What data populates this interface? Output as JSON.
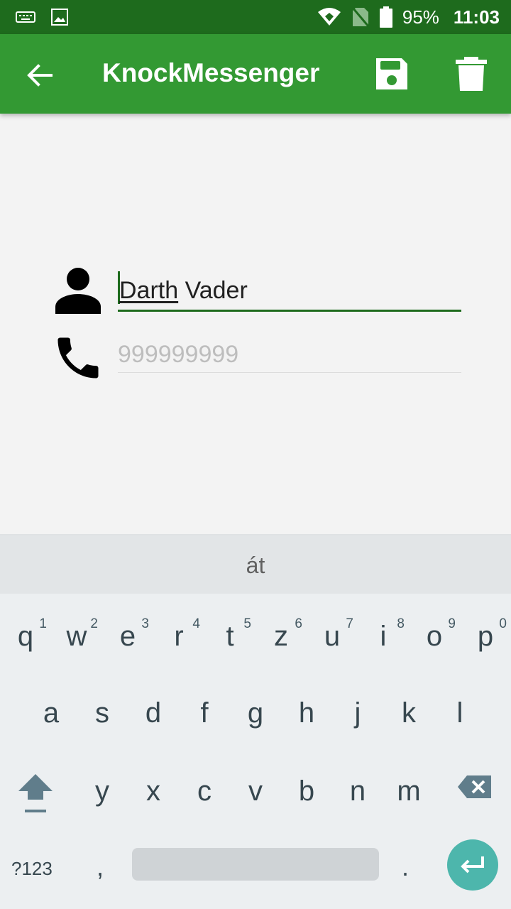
{
  "status_bar": {
    "battery": "95%",
    "time": "11:03"
  },
  "app_bar": {
    "title": "KnockMessenger",
    "icons": [
      "arrow-back-icon",
      "save-icon",
      "delete-icon"
    ]
  },
  "form": {
    "name_value_underlined": "Darth",
    "name_value_rest": " Vader",
    "phone_placeholder": "999999999"
  },
  "keyboard": {
    "suggestion": "át",
    "row1": [
      {
        "letter": "q",
        "hint": "1"
      },
      {
        "letter": "w",
        "hint": "2"
      },
      {
        "letter": "e",
        "hint": "3"
      },
      {
        "letter": "r",
        "hint": "4"
      },
      {
        "letter": "t",
        "hint": "5"
      },
      {
        "letter": "z",
        "hint": "6"
      },
      {
        "letter": "u",
        "hint": "7"
      },
      {
        "letter": "i",
        "hint": "8"
      },
      {
        "letter": "o",
        "hint": "9"
      },
      {
        "letter": "p",
        "hint": "0"
      }
    ],
    "row2": [
      "a",
      "s",
      "d",
      "f",
      "g",
      "h",
      "j",
      "k",
      "l"
    ],
    "row3": [
      "y",
      "x",
      "c",
      "v",
      "b",
      "n",
      "m"
    ],
    "symbols_label": "?123",
    "comma_label": ",",
    "period_label": "."
  },
  "colors": {
    "status_bar": "#1e6b1d",
    "app_bar": "#339933",
    "accent": "#1e6b1d",
    "enter_key": "#4db6ac"
  }
}
